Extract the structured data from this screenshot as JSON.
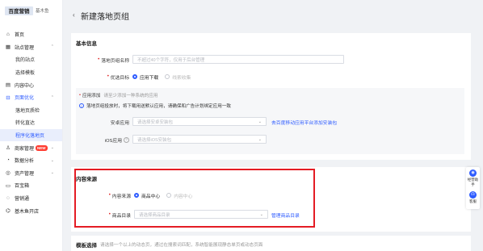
{
  "brand": {
    "logo": "百度营销",
    "sub": "基木鱼"
  },
  "sidebar": {
    "items": [
      {
        "label": "首页",
        "icon": "home-icon",
        "glyph": "⌂"
      },
      {
        "label": "站点管理",
        "icon": "grid-icon",
        "glyph": "▦",
        "chevron": "⌃"
      },
      {
        "label": "我的站点"
      },
      {
        "label": "选择模板"
      },
      {
        "label": "内容中心",
        "icon": "content-icon",
        "glyph": "▤"
      },
      {
        "label": "页面优化",
        "icon": "optimize-icon",
        "glyph": "⊟",
        "chevron": "⌃"
      },
      {
        "label": "落地页质检"
      },
      {
        "label": "转化直达"
      },
      {
        "label": "程序化落地页"
      },
      {
        "label": "商家管理",
        "icon": "merchant-icon",
        "glyph": "♙",
        "badge": "NEW",
        "chevron": "⌄"
      },
      {
        "label": "数据分析",
        "icon": "analytics-icon",
        "glyph": "◔",
        "chevron": "⌄"
      },
      {
        "label": "资产管理",
        "icon": "asset-icon",
        "glyph": "◎",
        "chevron": "⌄"
      },
      {
        "label": "百宝箱",
        "icon": "toolbox-icon",
        "glyph": "▭"
      },
      {
        "label": "营销通",
        "icon": "marketing-icon",
        "glyph": "◌"
      },
      {
        "label": "基木鱼开店",
        "icon": "shop-icon",
        "glyph": "⌬"
      }
    ]
  },
  "header": {
    "back": "‹",
    "title": "新建落地页组"
  },
  "basic": {
    "title": "基本信息",
    "name_label": "落地页组名称",
    "name_placeholder": "不超过40个字符，仅用于后台管理",
    "target_label": "优选目标",
    "target_opt1": "应用下载",
    "target_opt2": "线索收集",
    "app_add_label": "应用添加",
    "app_add_hint": "请至少添加一种系统的应用",
    "app_info": "落地页组投放时，将下载用送默认应用，请确保和广告计划绑定应用一致",
    "android_label": "安卓应用",
    "android_placeholder": "请选择安卓安装包",
    "android_link": "去百度移动应用平台添加安装包",
    "ios_label": "iOS应用",
    "ios_placeholder": "请选择iOS安装包"
  },
  "content": {
    "title": "内容来源",
    "source_label": "内容来源",
    "source_opt1": "商品中心",
    "source_opt2": "内容中心",
    "catalog_label": "商品目录",
    "catalog_placeholder": "请选择商品目录",
    "catalog_link": "管理商品目录"
  },
  "template": {
    "title": "模板选择",
    "hint": "请选择一个以上的动态页，通过在搜索词匹配，系统智能展现静态单页或动态页面"
  },
  "float": {
    "item1": "经营助手",
    "item2": "客服"
  },
  "colors": {
    "accent": "#2d5bff",
    "highlight": "#e41c24",
    "required": "#e02020"
  }
}
